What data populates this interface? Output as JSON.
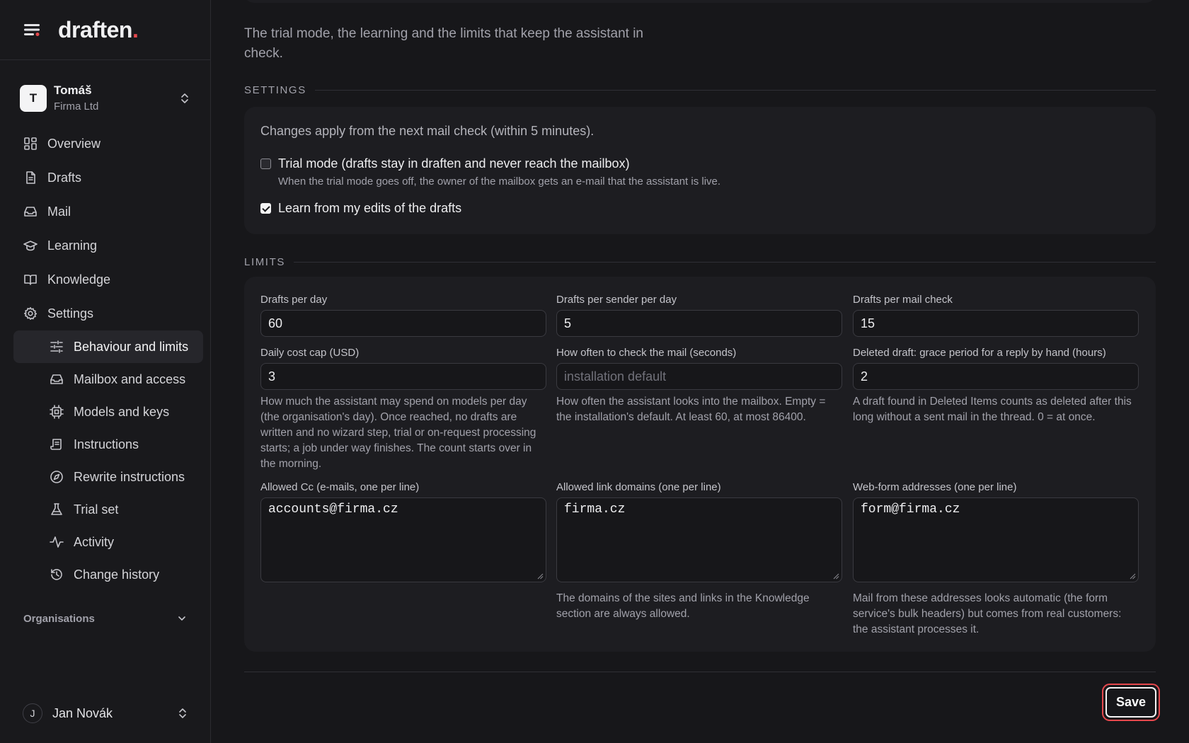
{
  "app": {
    "brand": "draften",
    "brand_dot": ".",
    "accent_color": "#e5484d"
  },
  "sidebar": {
    "org_switcher": {
      "initial": "T",
      "user": "Tomáš",
      "org": "Firma Ltd"
    },
    "nav": [
      {
        "label": "Overview",
        "icon": "grid-icon"
      },
      {
        "label": "Drafts",
        "icon": "document-icon"
      },
      {
        "label": "Mail",
        "icon": "inbox-icon"
      },
      {
        "label": "Learning",
        "icon": "graduation-cap-icon"
      },
      {
        "label": "Knowledge",
        "icon": "book-icon"
      },
      {
        "label": "Settings",
        "icon": "gear-icon"
      }
    ],
    "settings_sub": [
      {
        "label": "Behaviour and limits",
        "icon": "sliders-icon",
        "active": true
      },
      {
        "label": "Mailbox and access",
        "icon": "inbox-icon"
      },
      {
        "label": "Models and keys",
        "icon": "chip-icon"
      },
      {
        "label": "Instructions",
        "icon": "scroll-icon"
      },
      {
        "label": "Rewrite instructions",
        "icon": "compass-icon"
      },
      {
        "label": "Trial set",
        "icon": "flask-icon"
      },
      {
        "label": "Activity",
        "icon": "activity-icon"
      },
      {
        "label": "Change history",
        "icon": "history-icon"
      }
    ],
    "organisations_label": "Organisations",
    "footer_user": {
      "initial": "J",
      "name": "Jan Novák"
    }
  },
  "main": {
    "intro": "The trial mode, the learning and the limits that keep the assistant in check.",
    "settings": {
      "title": "SETTINGS",
      "notice": "Changes apply from the next mail check (within 5 minutes).",
      "trial_mode": {
        "label": "Trial mode (drafts stay in draften and never reach the mailbox)",
        "hint": "When the trial mode goes off, the owner of the mailbox gets an e-mail that the assistant is live.",
        "checked": false
      },
      "learn": {
        "label": "Learn from my edits of the drafts",
        "checked": true
      }
    },
    "limits": {
      "title": "LIMITS",
      "drafts_per_day": {
        "label": "Drafts per day",
        "value": "60"
      },
      "drafts_per_sender": {
        "label": "Drafts per sender per day",
        "value": "5"
      },
      "drafts_per_check": {
        "label": "Drafts per mail check",
        "value": "15"
      },
      "daily_cost_cap": {
        "label": "Daily cost cap (USD)",
        "value": "3",
        "help": "How much the assistant may spend on models per day (the organisation's day). Once reached, no drafts are written and no wizard step, trial or on-request processing starts; a job under way finishes. The count starts over in the morning."
      },
      "check_interval": {
        "label": "How often to check the mail (seconds)",
        "placeholder": "installation default",
        "help": "How often the assistant looks into the mailbox. Empty = the installation's default. At least 60, at most 86400."
      },
      "grace_period": {
        "label": "Deleted draft: grace period for a reply by hand (hours)",
        "value": "2",
        "help": "A draft found in Deleted Items counts as deleted after this long without a sent mail in the thread. 0 = at once."
      },
      "allowed_cc": {
        "label": "Allowed Cc (e-mails, one per line)",
        "value": "accounts@firma.cz"
      },
      "allowed_domains": {
        "label": "Allowed link domains (one per line)",
        "value": "firma.cz",
        "help": "The domains of the sites and links in the Knowledge section are always allowed."
      },
      "webform_addresses": {
        "label": "Web-form addresses (one per line)",
        "value": "form@firma.cz",
        "help": "Mail from these addresses looks automatic (the form service's bulk headers) but comes from real customers: the assistant processes it."
      }
    },
    "save_label": "Save"
  }
}
